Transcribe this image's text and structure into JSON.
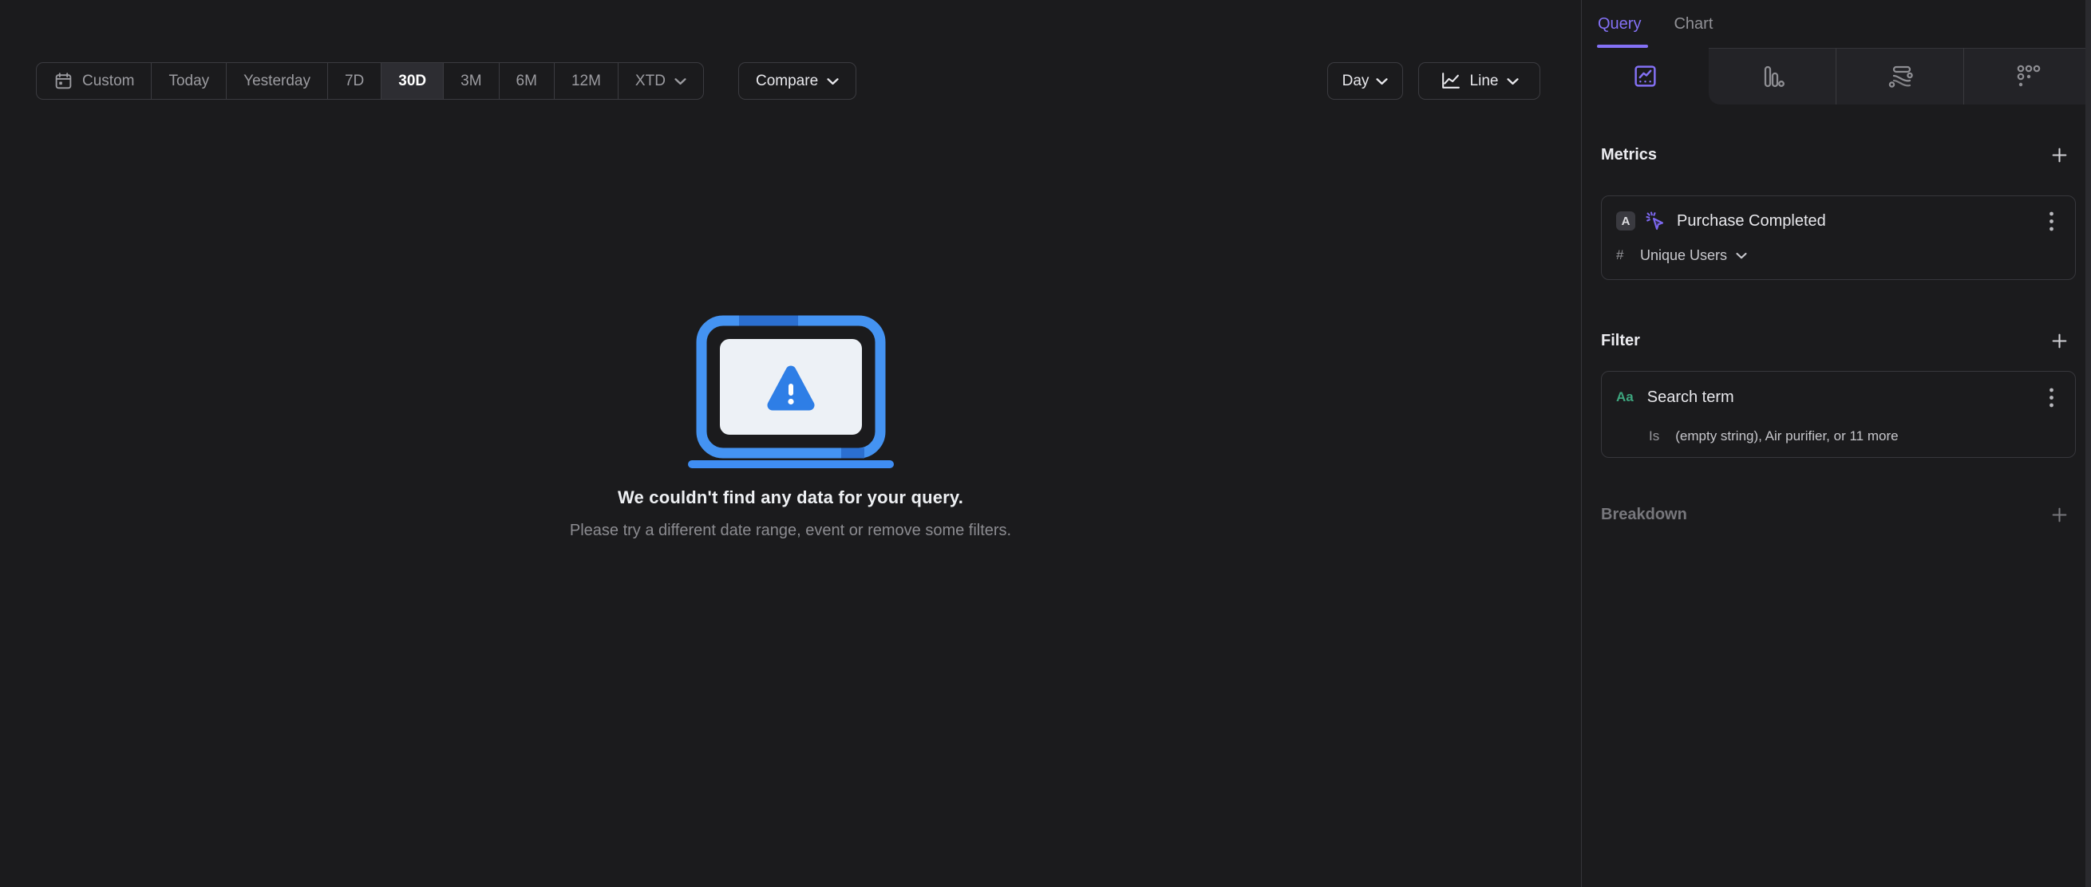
{
  "toolbar": {
    "date_ranges": [
      {
        "label": "Custom",
        "selected": false
      },
      {
        "label": "Today",
        "selected": false
      },
      {
        "label": "Yesterday",
        "selected": false
      },
      {
        "label": "7D",
        "selected": false
      },
      {
        "label": "30D",
        "selected": true
      },
      {
        "label": "3M",
        "selected": false
      },
      {
        "label": "6M",
        "selected": false
      },
      {
        "label": "12M",
        "selected": false
      },
      {
        "label": "XTD",
        "selected": false
      }
    ],
    "compare_label": "Compare",
    "granularity_label": "Day",
    "chart_type_label": "Line"
  },
  "empty_state": {
    "title": "We couldn't find any data for your query.",
    "subtitle": "Please try a different date range, event or remove some filters."
  },
  "sidebar": {
    "tabs": [
      {
        "label": "Query",
        "active": true
      },
      {
        "label": "Chart",
        "active": false
      }
    ],
    "report_tab_icons": [
      "insights-icon",
      "funnel-icon",
      "flow-icon",
      "retention-icon"
    ],
    "metrics": {
      "header": "Metrics",
      "items": [
        {
          "series_letter": "A",
          "event_name": "Purchase Completed",
          "aggregation_symbol": "#",
          "aggregation_label": "Unique Users"
        }
      ]
    },
    "filter": {
      "header": "Filter",
      "items": [
        {
          "type_badge": "Aa",
          "property_name": "Search term",
          "operator": "Is",
          "values_summary": "(empty string), Air purifier, or 11 more"
        }
      ]
    },
    "breakdown": {
      "header": "Breakdown"
    }
  },
  "icons": {
    "calendar-icon": "date range picker",
    "chevron-down-icon": "expand dropdown",
    "line-chart-icon": "line chart type",
    "insights-icon": "insights report (active)",
    "funnel-icon": "funnels report",
    "flow-icon": "flows report",
    "retention-icon": "retention report",
    "cursor-click-icon": "event",
    "plus-icon": "add item",
    "kebab-icon": "item options",
    "warning-laptop-illustration": "no data found"
  },
  "colors": {
    "background": "#1b1b1d",
    "accent_purple": "#8471f5",
    "accent_green": "#3da57e",
    "illustration_blue": "#4493f2",
    "illustration_blue_dark": "#2b6fd0",
    "selected_pill": "#2d2d32",
    "border": "#3b3b40",
    "text_primary": "#e9e9ed",
    "text_secondary": "#9c9ca1"
  }
}
